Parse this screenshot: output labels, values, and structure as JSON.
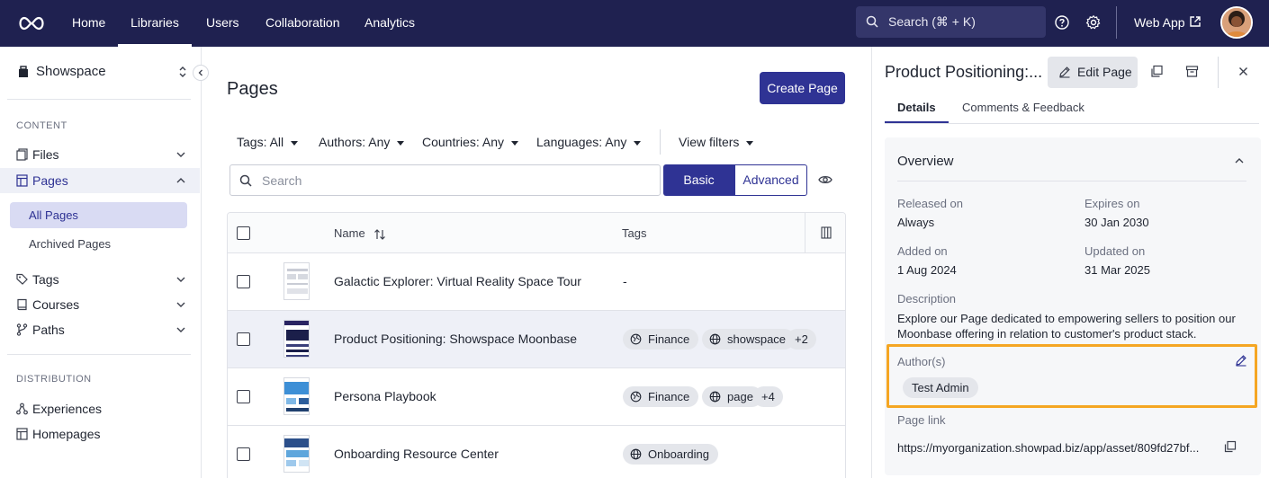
{
  "topnav": {
    "items": [
      "Home",
      "Libraries",
      "Users",
      "Collaboration",
      "Analytics"
    ],
    "active": "Libraries",
    "search_placeholder": "Search (⌘ + K)",
    "webapp_label": "Web App"
  },
  "sidebar": {
    "workspace": "Showspace",
    "section_content": "CONTENT",
    "files": "Files",
    "pages": "Pages",
    "all_pages": "All Pages",
    "archived_pages": "Archived Pages",
    "tags": "Tags",
    "courses": "Courses",
    "paths": "Paths",
    "section_distribution": "DISTRIBUTION",
    "experiences": "Experiences",
    "homepages": "Homepages"
  },
  "main": {
    "title": "Pages",
    "create_button": "Create Page",
    "filters": [
      "Tags: All",
      "Authors: Any",
      "Countries: Any",
      "Languages: Any",
      "View filters"
    ],
    "search_placeholder": "Search",
    "mode_basic": "Basic",
    "mode_advanced": "Advanced",
    "columns": {
      "name": "Name",
      "tags": "Tags"
    },
    "rows": [
      {
        "name": "Galactic Explorer: Virtual Reality Space Tour",
        "tags": "-"
      },
      {
        "name": "Product Positioning: Showspace Moonbase",
        "tag1": "Finance",
        "tag2": "showspace",
        "more": "+2"
      },
      {
        "name": "Persona Playbook",
        "tag1": "Finance",
        "tag2": "page",
        "more": "+4"
      },
      {
        "name": "Onboarding Resource Center",
        "tag1": "Onboarding"
      }
    ]
  },
  "panel": {
    "title": "Product Positioning:...",
    "edit_button": "Edit Page",
    "tab_details": "Details",
    "tab_comments": "Comments & Feedback",
    "overview_title": "Overview",
    "released_label": "Released on",
    "released_value": "Always",
    "expires_label": "Expires on",
    "expires_value": "30 Jan 2030",
    "added_label": "Added on",
    "added_value": "1 Aug 2024",
    "updated_label": "Updated on",
    "updated_value": "31 Mar 2025",
    "description_label": "Description",
    "description_value": "Explore our Page dedicated to empowering sellers to position our Moonbase offering in relation to customer's product stack.",
    "authors_label": "Author(s)",
    "author_name": "Test Admin",
    "pagelink_label": "Page link",
    "pagelink_value": "https://myorganization.showpad.biz/app/asset/809fd27bf..."
  },
  "colors": {
    "nav_bg": "#1f2150",
    "accent": "#2f3394",
    "highlight": "#f5a623"
  }
}
